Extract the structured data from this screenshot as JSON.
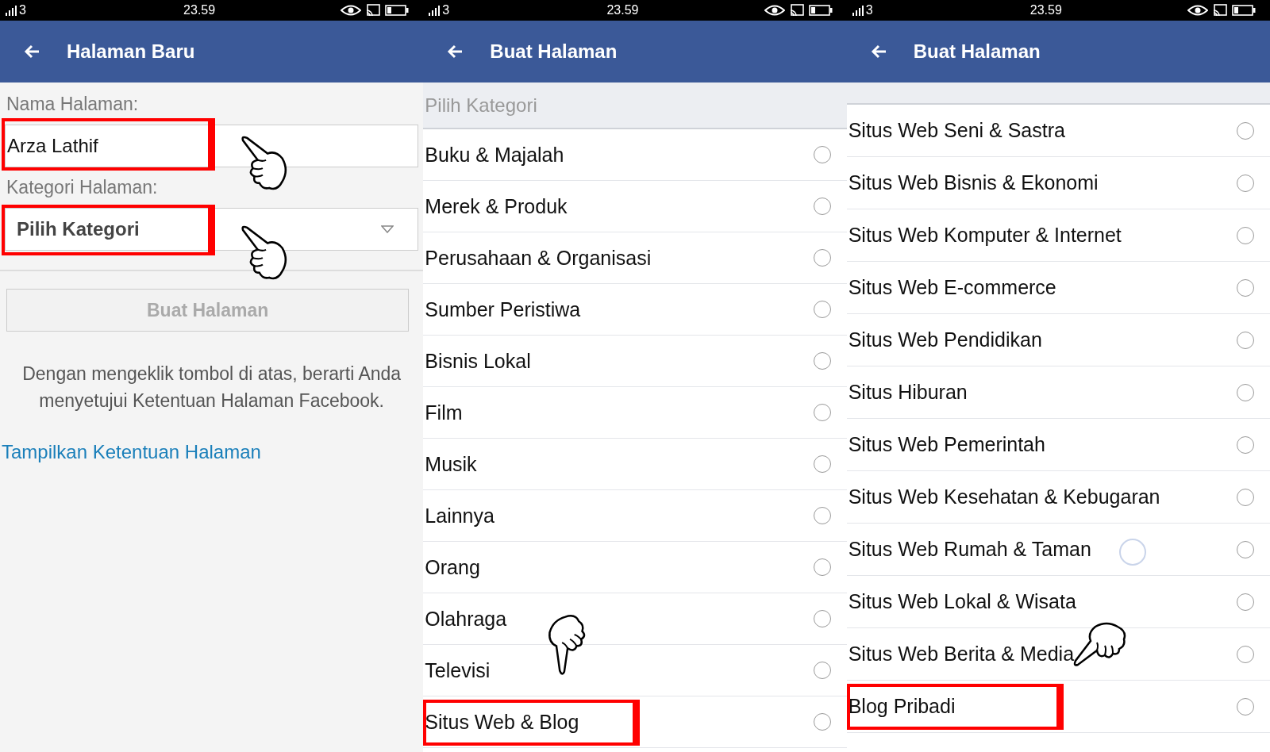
{
  "panels": [
    {
      "status_bar": {
        "signal": "3",
        "time": "23.59"
      },
      "title": "Halaman Baru",
      "kind": "form",
      "form": {
        "name_label": "Nama Halaman:",
        "name_value": "Arza Lathif",
        "name_highlight": true,
        "name_pointer": true,
        "category_label": "Kategori Halaman:",
        "category_value": "Pilih Kategori",
        "category_highlight": true,
        "category_pointer": true,
        "button": "Buat Halaman",
        "button_disabled": true,
        "terms": "Dengan mengeklik tombol di atas, berarti Anda menyetujui Ketentuan Halaman Facebook.",
        "link": "Tampilkan Ketentuan Halaman"
      }
    },
    {
      "status_bar": {
        "signal": "3",
        "time": "23.59"
      },
      "title": "Buat Halaman",
      "kind": "list",
      "list_header": "Pilih Kategori",
      "loading": false,
      "items": [
        {
          "label": "Buku & Majalah",
          "selected": false,
          "highlight": false,
          "pointer": false
        },
        {
          "label": "Merek & Produk",
          "selected": false,
          "highlight": false,
          "pointer": false
        },
        {
          "label": "Perusahaan & Organisasi",
          "selected": false,
          "highlight": false,
          "pointer": false
        },
        {
          "label": "Sumber Peristiwa",
          "selected": false,
          "highlight": false,
          "pointer": false
        },
        {
          "label": "Bisnis Lokal",
          "selected": false,
          "highlight": false,
          "pointer": false
        },
        {
          "label": "Film",
          "selected": false,
          "highlight": false,
          "pointer": false
        },
        {
          "label": "Musik",
          "selected": false,
          "highlight": false,
          "pointer": false
        },
        {
          "label": "Lainnya",
          "selected": false,
          "highlight": false,
          "pointer": false
        },
        {
          "label": "Orang",
          "selected": false,
          "highlight": false,
          "pointer": false
        },
        {
          "label": "Olahraga",
          "selected": false,
          "highlight": false,
          "pointer": true
        },
        {
          "label": "Televisi",
          "selected": false,
          "highlight": false,
          "pointer": false
        },
        {
          "label": "Situs Web & Blog",
          "selected": false,
          "highlight": true,
          "pointer": false
        }
      ]
    },
    {
      "status_bar": {
        "signal": "3",
        "time": "23.59"
      },
      "title": "Buat Halaman",
      "kind": "list",
      "loading": true,
      "items": [
        {
          "label": "Situs Web Seni & Sastra",
          "selected": false,
          "highlight": false,
          "pointer": false
        },
        {
          "label": "Situs Web Bisnis & Ekonomi",
          "selected": false,
          "highlight": false,
          "pointer": false
        },
        {
          "label": "Situs Web Komputer & Internet",
          "selected": false,
          "highlight": false,
          "pointer": false
        },
        {
          "label": "Situs Web E-commerce",
          "selected": false,
          "highlight": false,
          "pointer": false
        },
        {
          "label": "Situs Web Pendidikan",
          "selected": false,
          "highlight": false,
          "pointer": false
        },
        {
          "label": "Situs Hiburan",
          "selected": false,
          "highlight": false,
          "pointer": false
        },
        {
          "label": "Situs Web Pemerintah",
          "selected": false,
          "highlight": false,
          "pointer": false
        },
        {
          "label": "Situs Web Kesehatan & Kebugaran",
          "selected": false,
          "highlight": false,
          "pointer": false
        },
        {
          "label": "Situs Web Rumah & Taman",
          "selected": false,
          "highlight": false,
          "pointer": false
        },
        {
          "label": "Situs Web Lokal & Wisata",
          "selected": false,
          "highlight": false,
          "pointer": false
        },
        {
          "label": "Situs Web Berita & Media",
          "selected": false,
          "highlight": false,
          "pointer": true
        },
        {
          "label": "Blog Pribadi",
          "selected": false,
          "highlight": true,
          "pointer": false
        }
      ]
    }
  ]
}
